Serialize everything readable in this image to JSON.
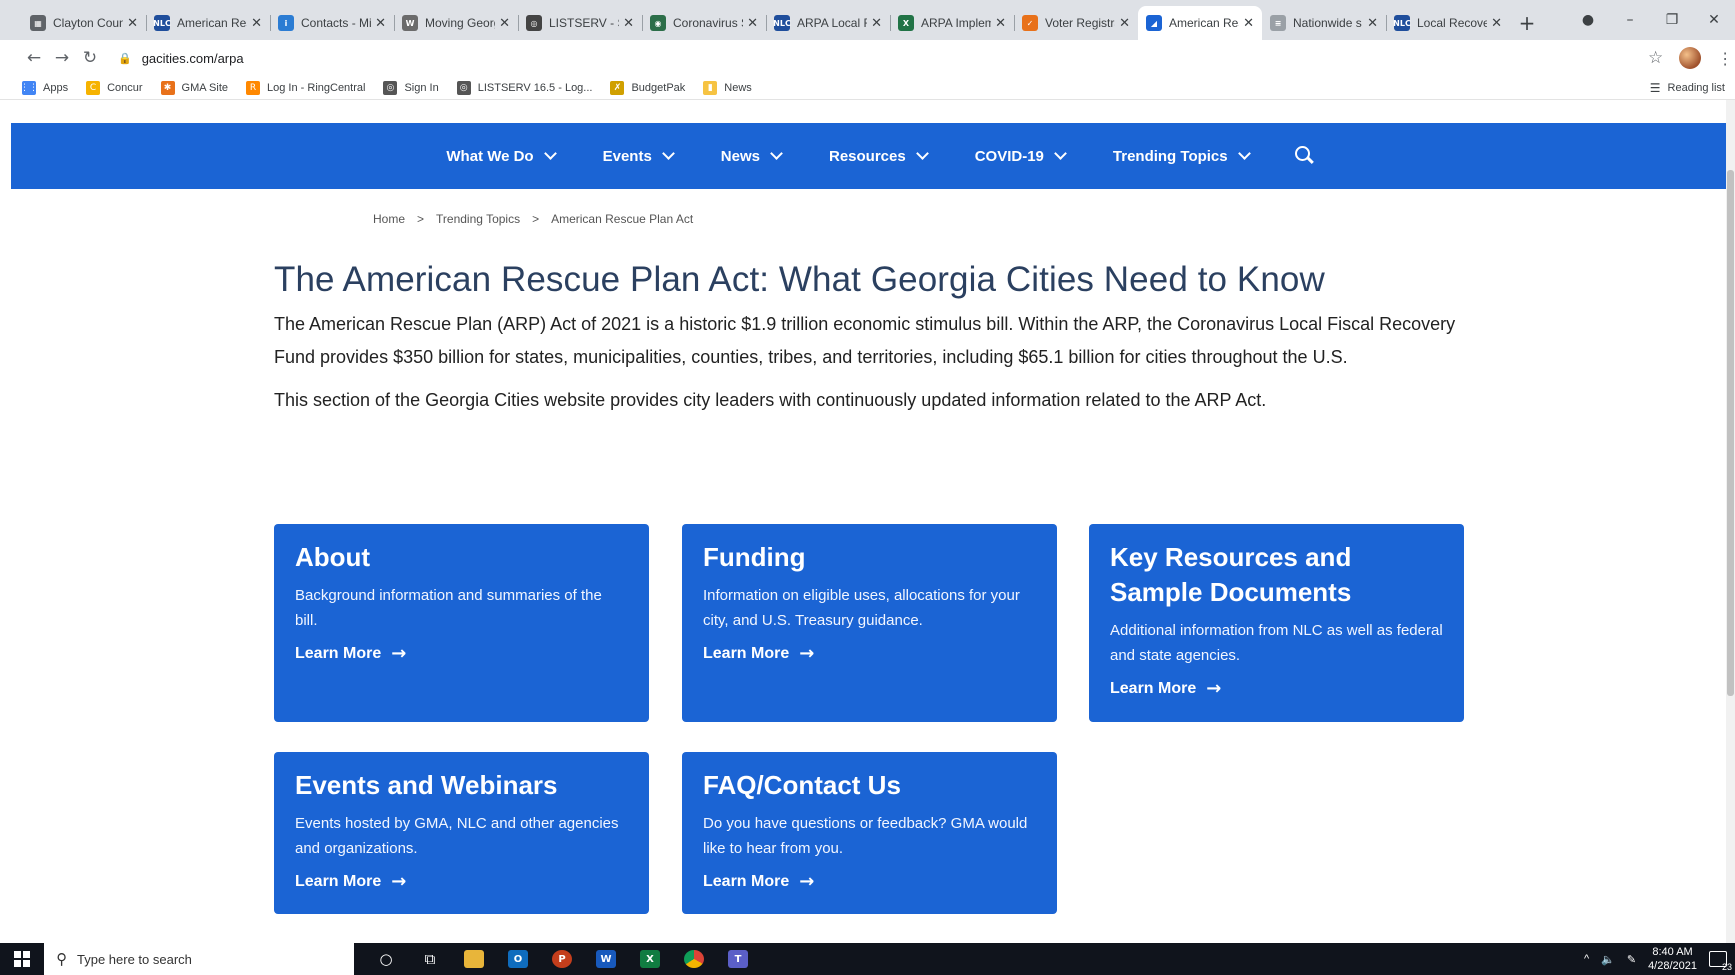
{
  "browser": {
    "tabs": [
      {
        "title": "Clayton County",
        "icon": "#5f6368",
        "glyph": "▦"
      },
      {
        "title": "American Rescue",
        "icon": "#1f4e9c",
        "glyph": "NLC"
      },
      {
        "title": "Contacts - Mi",
        "icon": "#2b7cd3",
        "glyph": "i"
      },
      {
        "title": "Moving Georgia",
        "icon": "#6b6b6b",
        "glyph": "W"
      },
      {
        "title": "LISTSERV - Su",
        "icon": "#444444",
        "glyph": "◎"
      },
      {
        "title": "Coronavirus S",
        "icon": "#2c6e49",
        "glyph": "◉"
      },
      {
        "title": "ARPA Local Re",
        "icon": "#1f4e9c",
        "glyph": "NLC"
      },
      {
        "title": "ARPA Implem",
        "icon": "#217346",
        "glyph": "X"
      },
      {
        "title": "Voter Registra",
        "icon": "#e8711a",
        "glyph": "✓"
      },
      {
        "title": "American Res",
        "icon": "#1b64d4",
        "glyph": "◢"
      },
      {
        "title": "Nationwide s",
        "icon": "#9aa0a6",
        "glyph": "≡"
      },
      {
        "title": "Local Recover",
        "icon": "#1f4e9c",
        "glyph": "NLC"
      }
    ],
    "active_tab": 9,
    "url": "gacities.com/arpa",
    "bookmarks": [
      {
        "label": "Apps",
        "icon": "#4285f4",
        "glyph": "⋮⋮"
      },
      {
        "label": "Concur",
        "icon": "#f6b300",
        "glyph": "C"
      },
      {
        "label": "GMA Site",
        "icon": "#e8711a",
        "glyph": "✱"
      },
      {
        "label": "Log In - RingCentral",
        "icon": "#ff8800",
        "glyph": "R"
      },
      {
        "label": "Sign In",
        "icon": "#555555",
        "glyph": "◎"
      },
      {
        "label": "LISTSERV 16.5 - Log...",
        "icon": "#555555",
        "glyph": "◎"
      },
      {
        "label": "BudgetPak",
        "icon": "#d0a000",
        "glyph": "✗"
      },
      {
        "label": "News",
        "icon": "#f6c342",
        "glyph": "▮"
      }
    ],
    "reading_list": "Reading list"
  },
  "nav": {
    "items": [
      "What We Do",
      "Events",
      "News",
      "Resources",
      "COVID-19",
      "Trending Topics"
    ]
  },
  "breadcrumb": [
    "Home",
    ">",
    "Trending Topics",
    ">",
    "American Rescue Plan Act"
  ],
  "page": {
    "title": "The American Rescue Plan Act: What Georgia Cities Need to Know",
    "intro": "The American Rescue Plan (ARP) Act of 2021 is a historic $1.9 trillion economic stimulus bill. Within the ARP, the Coronavirus Local Fiscal Recovery Fund provides $350 billion for states, municipalities, counties, tribes, and territories, including $65.1 billion for cities throughout the U.S.",
    "intro2": "This section of the Georgia Cities website provides city leaders with continuously updated information related to the ARP Act."
  },
  "cards": [
    {
      "title": "About",
      "desc": "Background information and summaries of the bill.",
      "link": "Learn More"
    },
    {
      "title": "Funding",
      "desc": "Information on eligible uses, allocations for your city, and U.S. Treasury guidance.",
      "link": "Learn More"
    },
    {
      "title": "Key Resources and Sample Documents",
      "desc": "Additional information from NLC as well as federal and state agencies.",
      "link": "Learn More"
    },
    {
      "title": "Events and Webinars",
      "desc": "Events hosted by GMA, NLC and other agencies and organizations.",
      "link": "Learn More"
    },
    {
      "title": "FAQ/Contact Us",
      "desc": "Do you have questions or feedback? GMA would like to hear from you.",
      "link": "Learn More"
    }
  ],
  "taskbar": {
    "search_placeholder": "Type here to search",
    "time": "8:40 AM",
    "date": "4/28/2021",
    "notification_count": "23"
  },
  "colors": {
    "brand_blue": "#1b64d4",
    "title_text": "#2b4060"
  }
}
